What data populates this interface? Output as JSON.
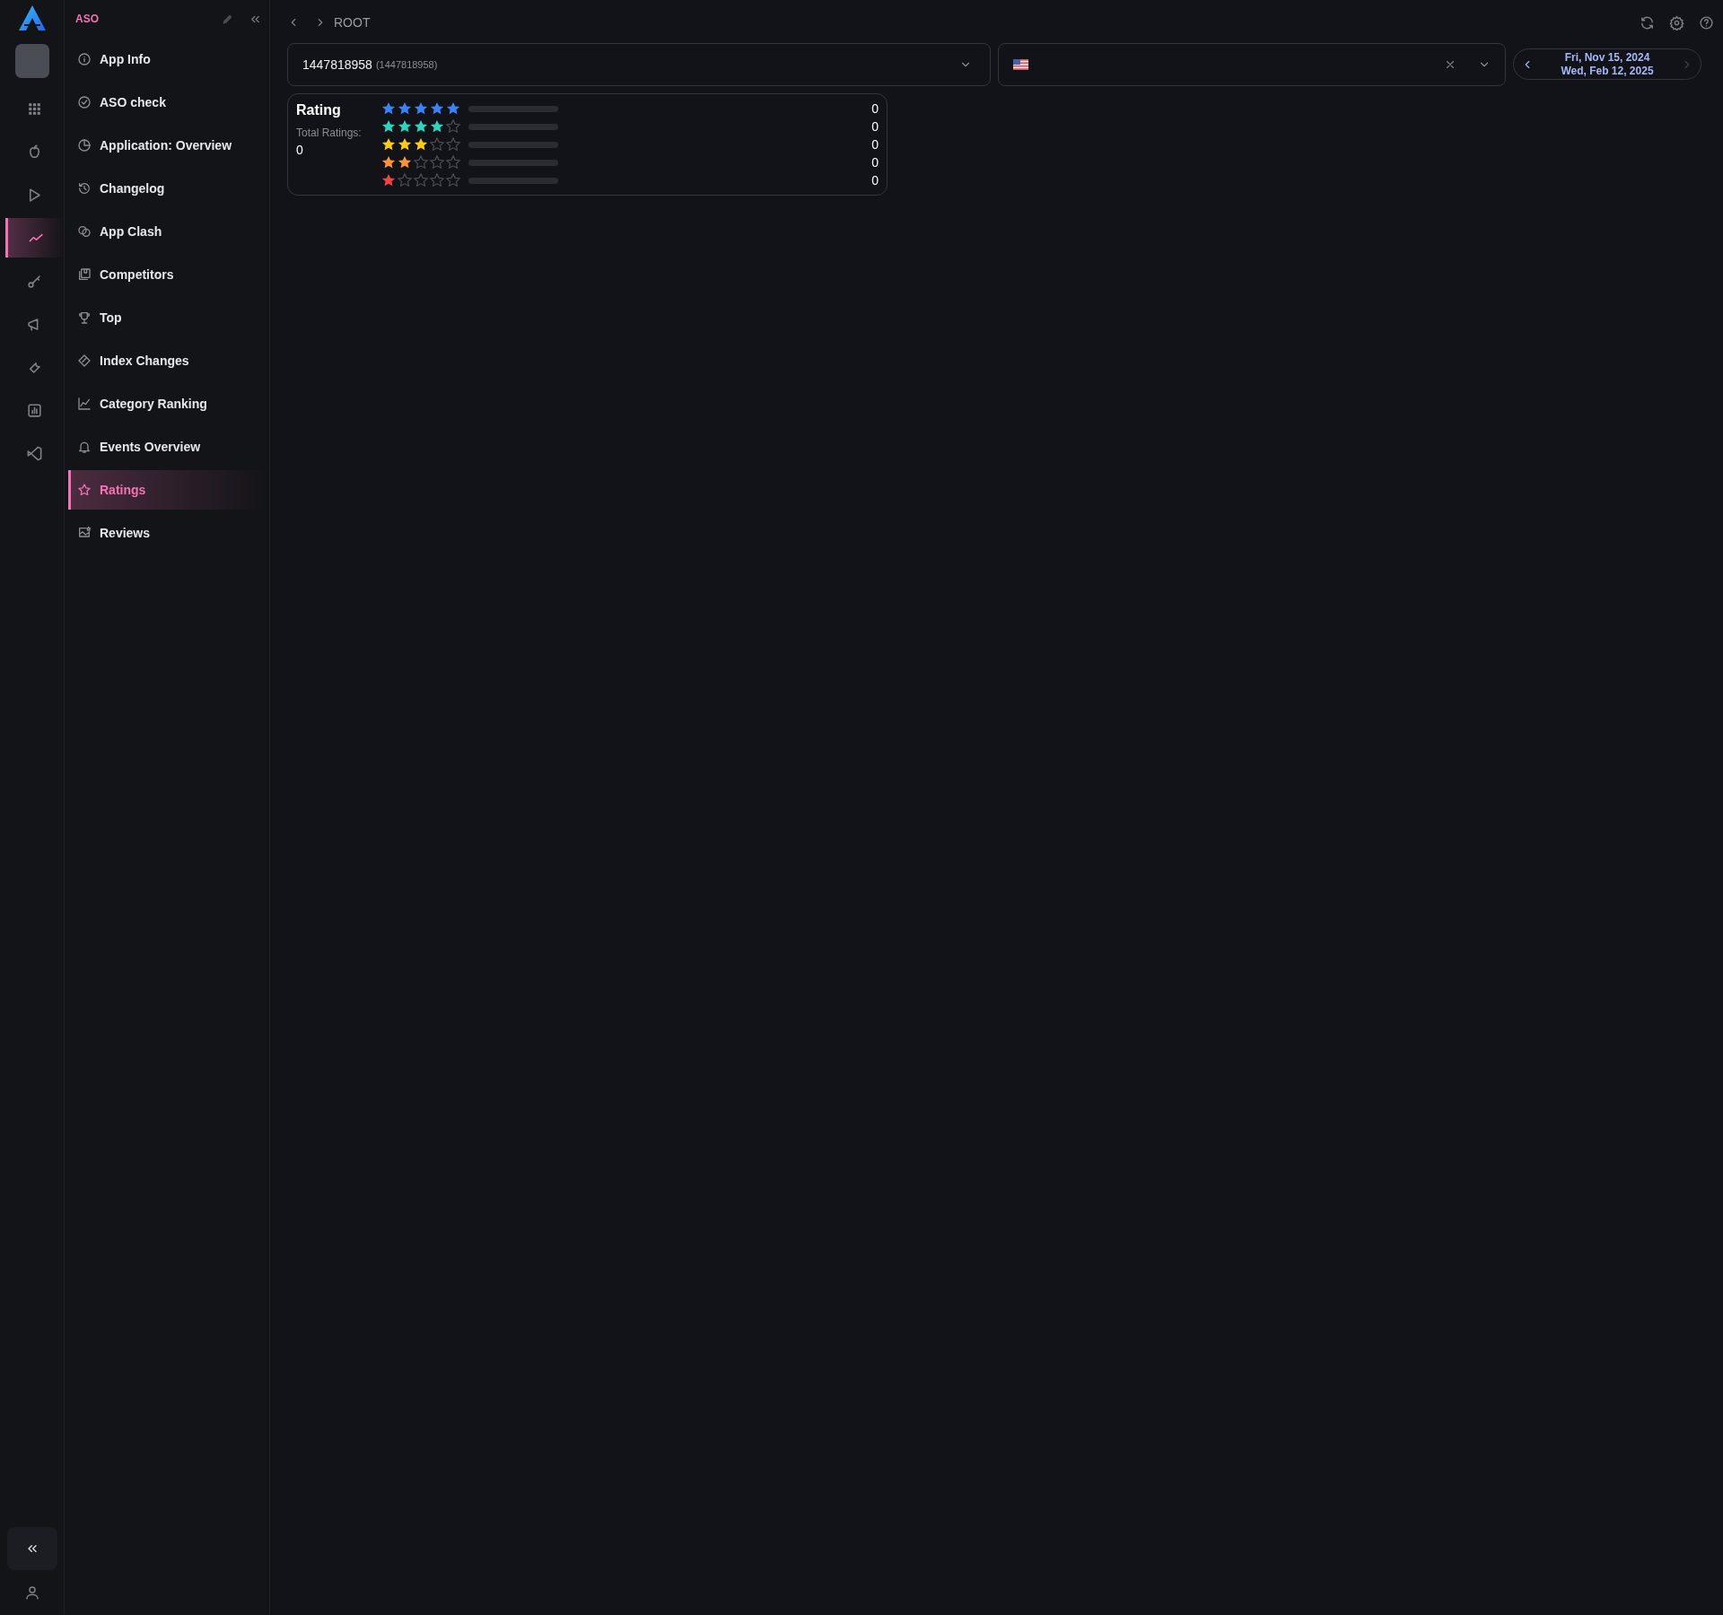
{
  "rail": {
    "items": [
      {
        "selected": false
      },
      {
        "selected": false
      },
      {
        "selected": false
      },
      {
        "selected": true
      },
      {
        "selected": false
      },
      {
        "selected": false
      },
      {
        "selected": false
      },
      {
        "selected": false
      },
      {
        "selected": false
      }
    ]
  },
  "sidebar": {
    "title": "ASO",
    "items": [
      {
        "label": "App Info",
        "selected": false
      },
      {
        "label": "ASO check",
        "selected": false
      },
      {
        "label": "Application: Overview",
        "selected": false
      },
      {
        "label": "Changelog",
        "selected": false
      },
      {
        "label": "App Clash",
        "selected": false
      },
      {
        "label": "Competitors",
        "selected": false
      },
      {
        "label": "Top",
        "selected": false
      },
      {
        "label": "Index Changes",
        "selected": false
      },
      {
        "label": "Category Ranking",
        "selected": false
      },
      {
        "label": "Events Overview",
        "selected": false
      },
      {
        "label": "Ratings",
        "selected": true
      },
      {
        "label": "Reviews",
        "selected": false
      }
    ]
  },
  "breadcrumb": "ROOT",
  "app_select": {
    "value": "1447818958",
    "secondary": "(1447818958)"
  },
  "date_range": {
    "start": "Fri, Nov 15, 2024",
    "end": "Wed, Feb 12, 2025",
    "next_disabled": true
  },
  "rating_card": {
    "title": "Rating",
    "total_label": "Total Ratings:",
    "total": "0",
    "rows": [
      {
        "stars": 5,
        "color": "#3b82f6",
        "level": 0,
        "count": "0"
      },
      {
        "stars": 4,
        "color": "#2dd4bf",
        "level": 0,
        "count": "0"
      },
      {
        "stars": 3,
        "color": "#facc15",
        "level": 0,
        "count": "0"
      },
      {
        "stars": 2,
        "color": "#fb923c",
        "level": 0,
        "count": "0"
      },
      {
        "stars": 1,
        "color": "#ef4444",
        "level": 0,
        "count": "0"
      }
    ]
  }
}
